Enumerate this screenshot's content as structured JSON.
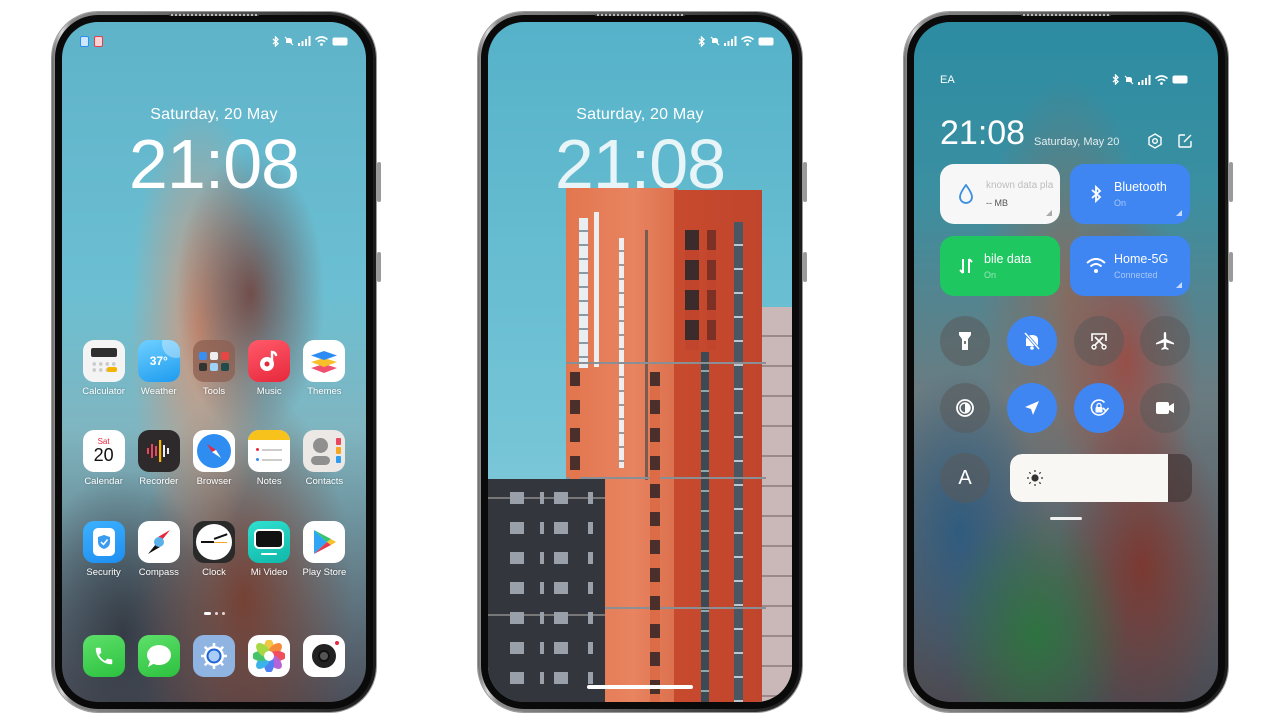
{
  "phones": [
    {
      "id": "home-screen",
      "status_bar": {
        "sim_badges": [
          {
            "color": "#2f8ff0"
          },
          {
            "color": "#e0414a"
          }
        ],
        "icons": [
          "bluetooth-icon",
          "mute-icon",
          "signal-icon",
          "wifi-icon",
          "battery-icon"
        ]
      },
      "date": "Saturday, 20 May",
      "time": "21:08",
      "apps": [
        {
          "label": "Calculator",
          "icon": "calculator-icon"
        },
        {
          "label": "Weather",
          "icon": "weather-icon",
          "badge": "37°"
        },
        {
          "label": "Tools",
          "icon": "tools-folder-icon"
        },
        {
          "label": "Music",
          "icon": "music-icon"
        },
        {
          "label": "Themes",
          "icon": "themes-icon"
        },
        {
          "label": "Calendar",
          "icon": "calendar-icon",
          "day": "Sat",
          "date": "20"
        },
        {
          "label": "Recorder",
          "icon": "recorder-icon"
        },
        {
          "label": "Browser",
          "icon": "browser-icon"
        },
        {
          "label": "Notes",
          "icon": "notes-icon"
        },
        {
          "label": "Contacts",
          "icon": "contacts-icon"
        },
        {
          "label": "Security",
          "icon": "security-icon"
        },
        {
          "label": "Compass",
          "icon": "compass-icon"
        },
        {
          "label": "Clock",
          "icon": "clock-icon"
        },
        {
          "label": "Mi Video",
          "icon": "mi-video-icon"
        },
        {
          "label": "Play Store",
          "icon": "play-store-icon"
        }
      ],
      "page_indicator": {
        "pages": 3,
        "current": 1
      },
      "dock": [
        {
          "icon": "phone-icon"
        },
        {
          "icon": "messages-icon"
        },
        {
          "icon": "settings-icon"
        },
        {
          "icon": "gallery-icon"
        },
        {
          "icon": "camera-icon"
        }
      ]
    },
    {
      "id": "lock-screen",
      "status_bar": {
        "icons": [
          "bluetooth-icon",
          "mute-icon",
          "signal-icon",
          "wifi-icon",
          "battery-icon"
        ]
      },
      "date": "Saturday, 20 May",
      "time": "21:08"
    },
    {
      "id": "control-center",
      "carrier": "EA",
      "status_bar": {
        "icons": [
          "bluetooth-icon",
          "mute-icon",
          "signal-icon",
          "wifi-icon",
          "battery-icon"
        ]
      },
      "time": "21:08",
      "date": "Saturday, May 20",
      "tiles": [
        {
          "title": "known data pla",
          "sub": "-- MB",
          "icon": "data-usage-icon",
          "state": "neutral"
        },
        {
          "title": "Bluetooth",
          "sub": "On",
          "icon": "bluetooth-icon",
          "state": "on"
        },
        {
          "title": "bile data",
          "sub": "On",
          "icon": "mobile-data-icon",
          "state": "on-green"
        },
        {
          "title": "Home-5G",
          "sub": "Connected",
          "icon": "wifi-icon",
          "state": "on"
        }
      ],
      "toggles": [
        {
          "icon": "flashlight-icon",
          "on": false
        },
        {
          "icon": "silent-bell-icon",
          "on": true
        },
        {
          "icon": "screenshot-icon",
          "on": false
        },
        {
          "icon": "airplane-icon",
          "on": false
        },
        {
          "icon": "dark-mode-icon",
          "on": false
        },
        {
          "icon": "location-icon",
          "on": true
        },
        {
          "icon": "rotation-lock-icon",
          "on": true
        },
        {
          "icon": "video-camera-icon",
          "on": false
        }
      ],
      "auto_brightness_label": "A",
      "brightness_percent": 87
    }
  ],
  "colors": {
    "toggle_on": "#3f86f2",
    "tile_green": "#1fc760",
    "tile_blue": "#3f86f2"
  }
}
